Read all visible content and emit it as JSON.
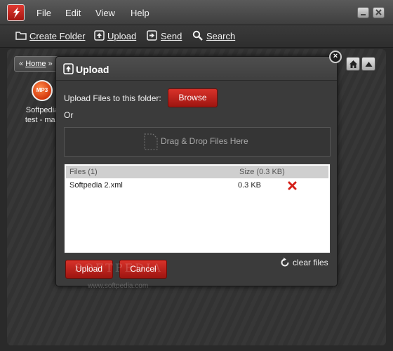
{
  "menu": {
    "file": "File",
    "edit": "Edit",
    "view": "View",
    "help": "Help"
  },
  "toolbar": {
    "create_folder": "Create Folder",
    "upload": "Upload",
    "send": "Send",
    "search": "Search"
  },
  "breadcrumb": {
    "back": "«",
    "home": "Home",
    "forward": "»"
  },
  "file_item": {
    "badge": "MP3",
    "name_line1": "Softpedia",
    "name_line2": "test - mac"
  },
  "dialog": {
    "title": "Upload",
    "close": "×",
    "upload_label": "Upload Files to this folder:",
    "browse": "Browse",
    "or": "Or",
    "dropzone": "Drag & Drop Files Here",
    "table": {
      "headers": [
        "Files (1)",
        "Size (0.3 KB)"
      ],
      "rows": [
        {
          "name": "Softpedia 2.xml",
          "size": "0.3 KB"
        }
      ]
    },
    "clear_files": "clear files",
    "upload_button": "Upload",
    "cancel_button": "Cancel"
  },
  "watermark": {
    "main": "SOFTPEDIA",
    "sub": "www.softpedia.com"
  },
  "colors": {
    "accent_red": "#c1221b",
    "window_bg": "#2a2a2a",
    "dialog_bg": "#3b3b3b"
  }
}
